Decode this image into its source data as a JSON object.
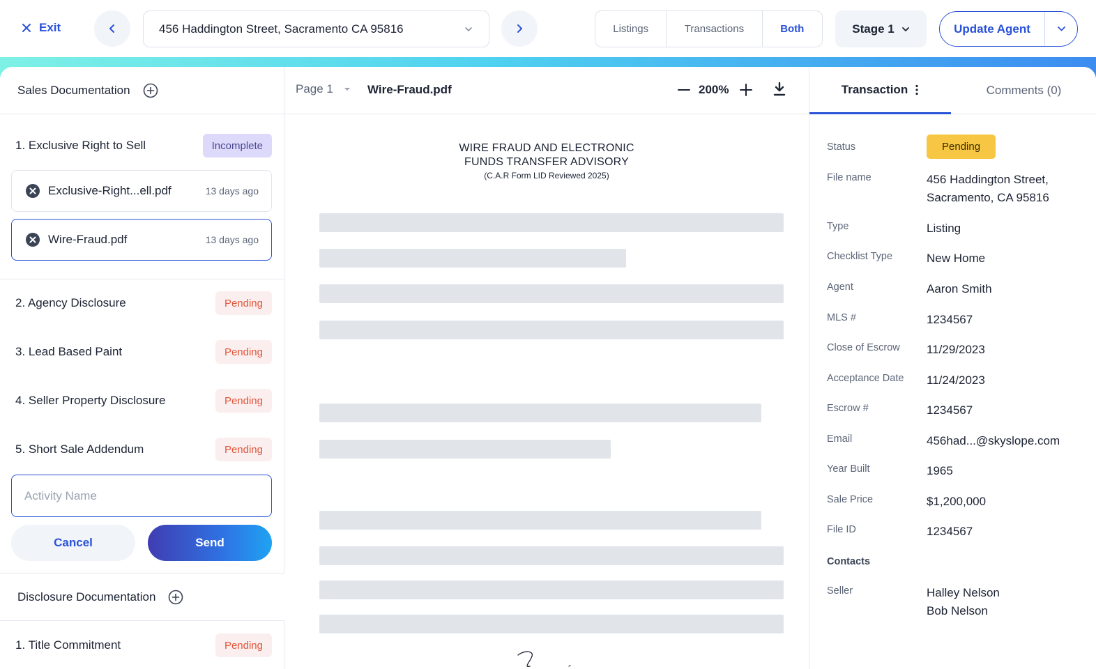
{
  "topbar": {
    "exit_label": "Exit",
    "address": "456 Haddington Street, Sacramento CA 95816",
    "segments": [
      "Listings",
      "Transactions",
      "Both"
    ],
    "active_segment": "Both",
    "stage_label": "Stage 1",
    "agent_button_label": "Update Agent"
  },
  "left": {
    "sales_section_title": "Sales Documentation",
    "items": [
      {
        "label": "1. Exclusive Right to Sell",
        "status": "Incomplete"
      },
      {
        "label": "2. Agency Disclosure",
        "status": "Pending"
      },
      {
        "label": "3. Lead Based Paint",
        "status": "Pending"
      },
      {
        "label": "4. Seller Property Disclosure",
        "status": "Pending"
      },
      {
        "label": "5. Short Sale Addendum",
        "status": "Pending"
      }
    ],
    "files": [
      {
        "name": "Exclusive-Right...ell.pdf",
        "date": "13 days ago"
      },
      {
        "name": "Wire-Fraud.pdf",
        "date": "13 days ago"
      }
    ],
    "activity_placeholder": "Activity Name",
    "cancel_label": "Cancel",
    "send_label": "Send",
    "disclosure_section_title": "Disclosure Documentation",
    "disclosure_items": [
      {
        "label": "1. Title Commitment",
        "status": "Pending"
      }
    ]
  },
  "viewer": {
    "page_label": "Page 1",
    "doc_name": "Wire-Fraud.pdf",
    "zoom": "200%",
    "doc_title_line1": "WIRE FRAUD AND ELECTRONIC",
    "doc_title_line2": "FUNDS TRANSFER ADVISORY",
    "doc_subtitle": "(C.A.R Form LID Reviewed 2025)"
  },
  "right": {
    "tabs": {
      "transaction": "Transaction",
      "comments": "Comments (0)"
    },
    "fields": {
      "status_label": "Status",
      "status_value": "Pending",
      "file_name_label": "File name",
      "file_name_line1": "456 Haddington Street,",
      "file_name_line2": "Sacramento, CA 95816",
      "type_label": "Type",
      "type_value": "Listing",
      "checklist_label": "Checklist Type",
      "checklist_value": "New Home",
      "agent_label": "Agent",
      "agent_value": "Aaron Smith",
      "mls_label": "MLS #",
      "mls_value": "1234567",
      "coe_label": "Close of Escrow",
      "coe_value": "11/29/2023",
      "acceptance_label": "Acceptance Date",
      "acceptance_value": "11/24/2023",
      "escrow_label": "Escrow #",
      "escrow_value": "1234567",
      "email_label": "Email",
      "email_value": "456had...@skyslope.com",
      "year_label": "Year Built",
      "year_value": "1965",
      "price_label": "Sale Price",
      "price_value": "$1,200,000",
      "fileid_label": "File ID",
      "fileid_value": "1234567",
      "contacts_label": "Contacts",
      "seller_label": "Seller",
      "seller_1": "Halley Nelson",
      "seller_2": "Bob Nelson"
    }
  },
  "colors": {
    "accent": "#2a52d9",
    "pending_badge_text": "#e2563b",
    "incomplete_badge_bg": "#dcd9fb",
    "status_pill": "#f7c744"
  }
}
